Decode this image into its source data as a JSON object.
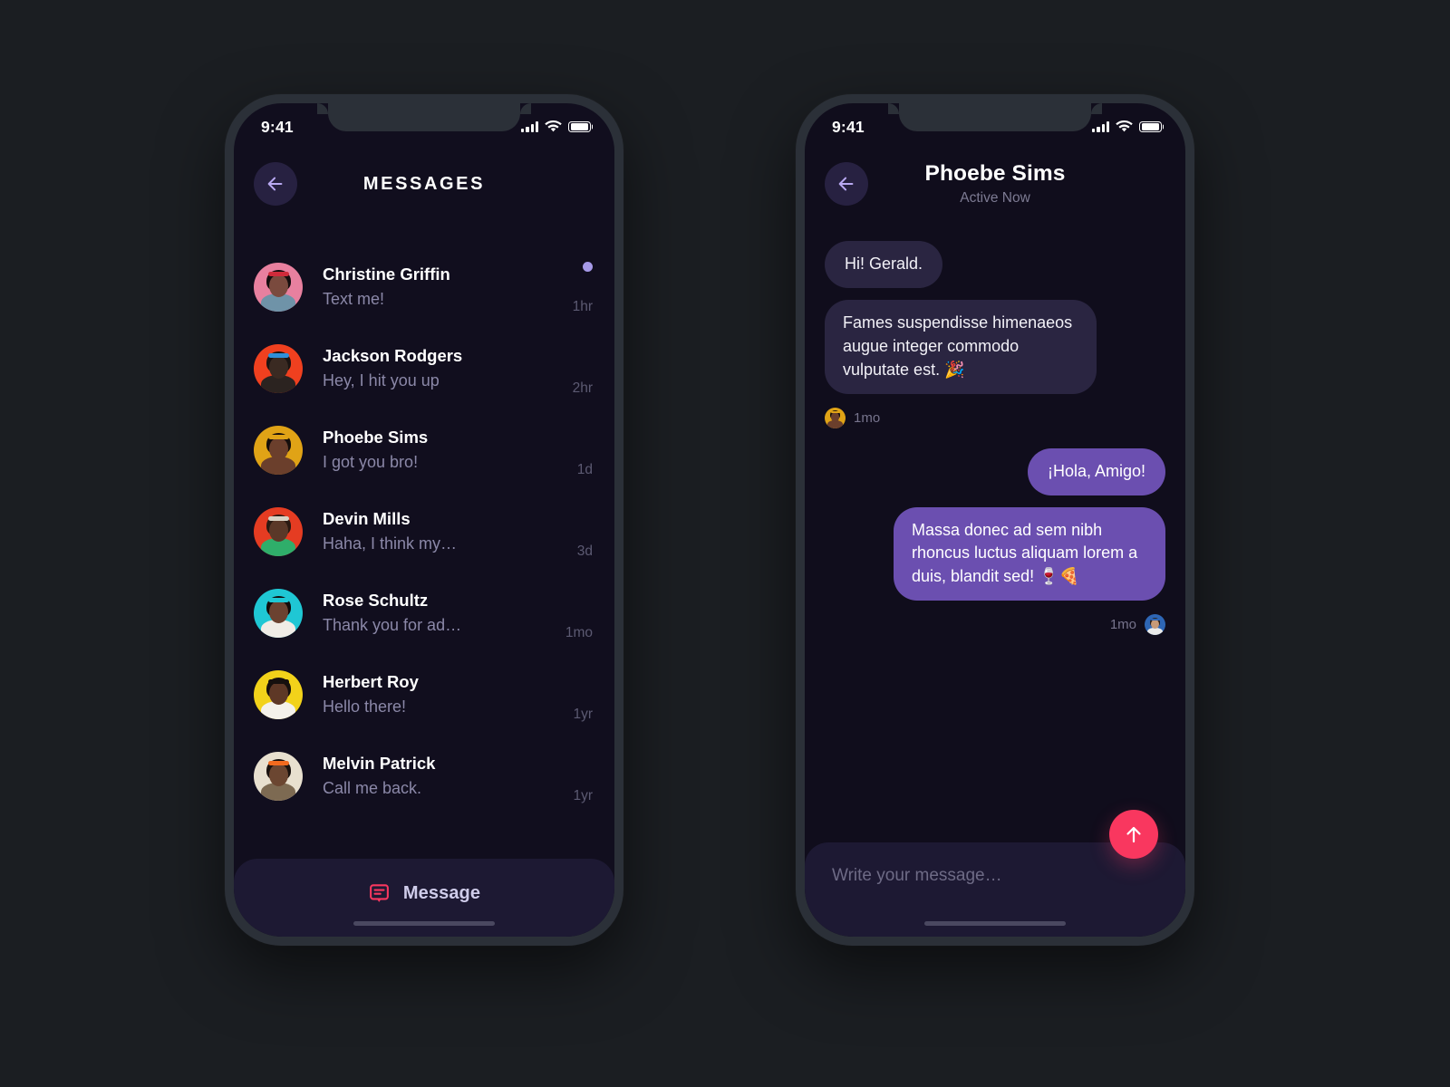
{
  "theme": {
    "page_bg": "#1b1e22",
    "phone_frame": "#2b3038",
    "screen_bg": "#110e1e",
    "accent_purple": "#6b4fb0",
    "accent_pink": "#f9375f",
    "unread_dot": "#a79ae8",
    "bubble_in": "#2a2541",
    "bar_bg": "#1d1933"
  },
  "status_bar": {
    "time": "9:41",
    "signal_icon": "signal-bars-icon",
    "wifi_icon": "wifi-icon",
    "battery_icon": "battery-icon"
  },
  "list_screen": {
    "back_icon": "arrow-left-icon",
    "title": "MESSAGES",
    "conversations": [
      {
        "name": "Christine Griffin",
        "preview": "Text me!",
        "time": "1hr",
        "unread": true,
        "avatar": "christine"
      },
      {
        "name": "Jackson Rodgers",
        "preview": "Hey, I hit you up",
        "time": "2hr",
        "unread": false,
        "avatar": "jackson"
      },
      {
        "name": "Phoebe Sims",
        "preview": "I got you bro!",
        "time": "1d",
        "unread": false,
        "avatar": "phoebe"
      },
      {
        "name": "Devin Mills",
        "preview": "Haha, I think my…",
        "time": "3d",
        "unread": false,
        "avatar": "devin"
      },
      {
        "name": "Rose Schultz",
        "preview": "Thank you for ad…",
        "time": "1mo",
        "unread": false,
        "avatar": "rose"
      },
      {
        "name": "Herbert Roy",
        "preview": "Hello there!",
        "time": "1yr",
        "unread": false,
        "avatar": "herbert"
      },
      {
        "name": "Melvin Patrick",
        "preview": "Call me back.",
        "time": "1yr",
        "unread": false,
        "avatar": "melvin"
      }
    ],
    "bottom_bar": {
      "icon": "message-bubble-icon",
      "label": "Message"
    },
    "home_indicator": "home-indicator"
  },
  "chat_screen": {
    "back_icon": "arrow-left-icon",
    "title": "Phoebe Sims",
    "subtitle": "Active Now",
    "messages": [
      {
        "side": "in",
        "text": "Hi! Gerald.",
        "short": true
      },
      {
        "side": "in",
        "text": "Fames suspendisse himenaeos augue integer commodo vulputate est. 🎉",
        "stamp": "1mo",
        "avatar": "phoebe"
      },
      {
        "side": "out",
        "text": "¡Hola, Amigo!",
        "short": true
      },
      {
        "side": "out",
        "text": "Massa donec ad sem nibh rhoncus luctus aliquam lorem a duis, blandit sed! 🍷🍕",
        "stamp": "1mo",
        "avatar": "gerald"
      }
    ],
    "composer": {
      "placeholder": "Write your message…",
      "value": ""
    },
    "send_button_icon": "arrow-up-icon",
    "home_indicator": "home-indicator"
  }
}
